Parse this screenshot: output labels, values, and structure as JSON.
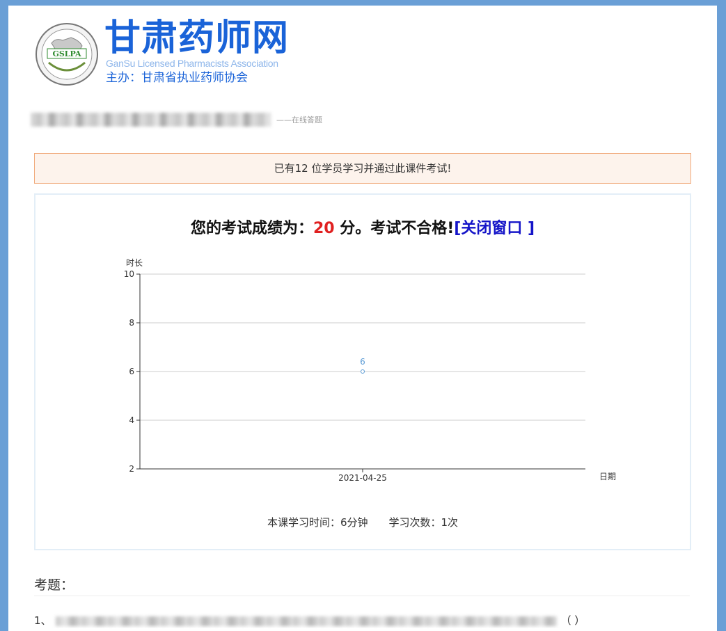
{
  "header": {
    "title": "甘肃药师网",
    "subtitle": "GanSu Licensed Pharmacists Association",
    "host": "主办：甘肃省执业药师协会",
    "logo_text": "GSLPA"
  },
  "course": {
    "suffix": "——在线答题"
  },
  "notice": {
    "text": "已有12 位学员学习并通过此课件考试!"
  },
  "result": {
    "prefix": "您的考试成绩为：",
    "score": "20",
    "suffix": " 分。考试不合格!",
    "close_label": "[关闭窗口 ]"
  },
  "chart_data": {
    "type": "line",
    "ylabel": "时长",
    "xlabel": "日期",
    "ylim": [
      2,
      10
    ],
    "yticks": [
      "2",
      "4",
      "6",
      "8",
      "10"
    ],
    "categories": [
      "2021-04-25"
    ],
    "series": [
      {
        "values": [
          6
        ]
      }
    ],
    "data_labels": [
      "6"
    ],
    "grid": true,
    "colors": {
      "series": "#5b9bd5",
      "grid": "#cccccc",
      "axis": "#333333"
    }
  },
  "stats": {
    "study_time": "本课学习时间：6分钟",
    "study_count": "学习次数：1次"
  },
  "questions": {
    "heading": "考题：",
    "q1_prefix": "1、",
    "q1_suffix": "（ ）"
  }
}
